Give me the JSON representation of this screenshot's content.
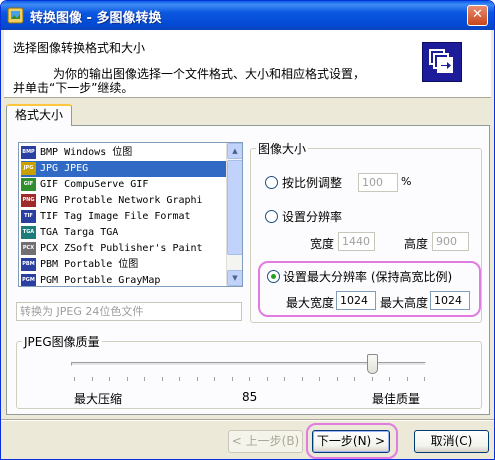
{
  "window": {
    "title": "转换图像 - 多图像转换",
    "close_glyph": "✕"
  },
  "header": {
    "title": "选择图像转换格式和大小",
    "desc_line1": "为你的输出图像选择一个文件格式、大小和相应格式设置，",
    "desc_line2": "并单击“下一步”继续。"
  },
  "tabs": [
    {
      "label": "格式大小"
    }
  ],
  "formats": [
    {
      "icon": "BMP",
      "color": "#2a3fa0",
      "label": "BMP Windows 位图"
    },
    {
      "icon": "JPG",
      "color": "#c8a000",
      "label": "JPG JPEG"
    },
    {
      "icon": "GIF",
      "color": "#2f8f2f",
      "label": "GIF CompuServe GIF"
    },
    {
      "icon": "PNG",
      "color": "#a02a2a",
      "label": "PNG Protable Network Graphi"
    },
    {
      "icon": "TIF",
      "color": "#2a3fa0",
      "label": "TIF Tag Image File Format"
    },
    {
      "icon": "TGA",
      "color": "#1f7a7a",
      "label": "TGA Targa TGA"
    },
    {
      "icon": "PCX",
      "color": "#707070",
      "label": "PCX ZSoft Publisher's Paint"
    },
    {
      "icon": "PBM",
      "color": "#2a3fa0",
      "label": "PBM Portable 位图"
    },
    {
      "icon": "PGM",
      "color": "#2a3fa0",
      "label": "PGM Portable GrayMap"
    }
  ],
  "selected_format_index": 1,
  "convert_to": "转换为 JPEG 24位色文件",
  "image_size": {
    "label": "图像大小",
    "scale_label": "按比例调整",
    "scale_value": "100",
    "scale_unit": "%",
    "resolution_label": "设置分辨率",
    "width_label": "宽度",
    "width_value": "1440",
    "height_label": "高度",
    "height_value": "900",
    "max_label": "设置最大分辨率 (保持高宽比例)",
    "max_width_label": "最大宽度",
    "max_width_value": "1024",
    "max_height_label": "最大高度",
    "max_height_value": "1024",
    "selected": "max"
  },
  "jpeg_quality": {
    "label": "JPEG图像质量",
    "value": 85,
    "value_text": "85",
    "min_label": "最大压缩",
    "max_label": "最佳质量"
  },
  "buttons": {
    "back": "< 上一步(B)",
    "next": "下一步(N) >",
    "cancel": "取消(C)"
  },
  "colors": {
    "title_bar": "#0b57e0",
    "selection": "#316ac5",
    "highlight_ring": "#e07be0"
  }
}
